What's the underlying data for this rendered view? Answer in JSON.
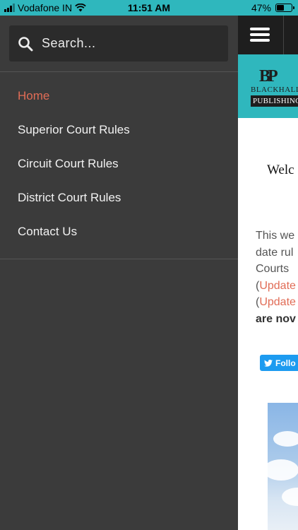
{
  "status_bar": {
    "carrier": "Vodafone IN",
    "time": "11:51 AM",
    "battery": "47%",
    "battery_level": 0.47
  },
  "drawer": {
    "search": {
      "placeholder": "Search..."
    },
    "menu": [
      {
        "label": "Home",
        "active": true
      },
      {
        "label": "Superior Court Rules"
      },
      {
        "label": "Circuit Court Rules"
      },
      {
        "label": "District Court Rules"
      },
      {
        "label": "Contact Us"
      }
    ]
  },
  "page": {
    "logo": {
      "mark": "BP",
      "top": "BLACKHALL",
      "bottom": "PUBLISHING"
    },
    "welcome": "Welc",
    "paragraph": {
      "line1": "This we",
      "line2": "date rul",
      "line3": "Courts",
      "line4_open": "(",
      "line4_link": "Update",
      "line5_open": "(",
      "line5_link": "Update",
      "line6": "are nov"
    },
    "follow_button": "Follo"
  },
  "colors": {
    "accent_teal": "#2fb7bd",
    "active_menu": "#e16c56",
    "drawer_bg": "#3b3b3b"
  }
}
